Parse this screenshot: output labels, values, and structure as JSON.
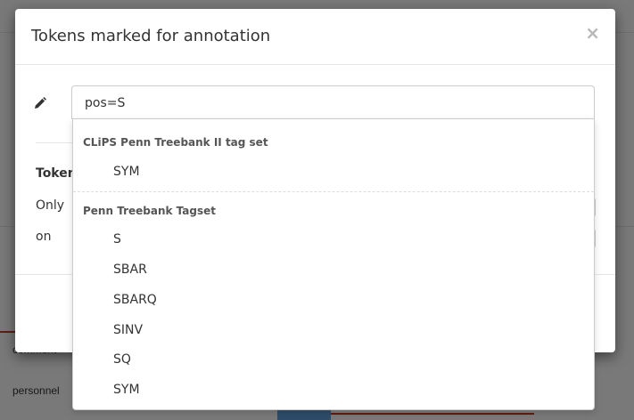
{
  "background": {
    "row1_label": "comment",
    "row2_label": "personnel"
  },
  "modal": {
    "title": "Tokens marked for annotation",
    "close_glyph": "×",
    "search": {
      "value": "pos=S",
      "placeholder": ""
    },
    "section_label": "Token",
    "option_only_label": "Only",
    "option_on_label": "on"
  },
  "dropdown": {
    "groups": [
      {
        "label": "CLiPS Penn Treebank II tag set",
        "options": [
          "SYM"
        ]
      },
      {
        "label": "Penn Treebank Tagset",
        "options": [
          "S",
          "SBAR",
          "SBARQ",
          "SINV",
          "SQ",
          "SYM"
        ]
      }
    ]
  },
  "icons": {
    "pencil": "pencil-icon",
    "close": "close-icon"
  },
  "colors": {
    "overlay": "#000000",
    "accent_line": "#c0392b"
  }
}
